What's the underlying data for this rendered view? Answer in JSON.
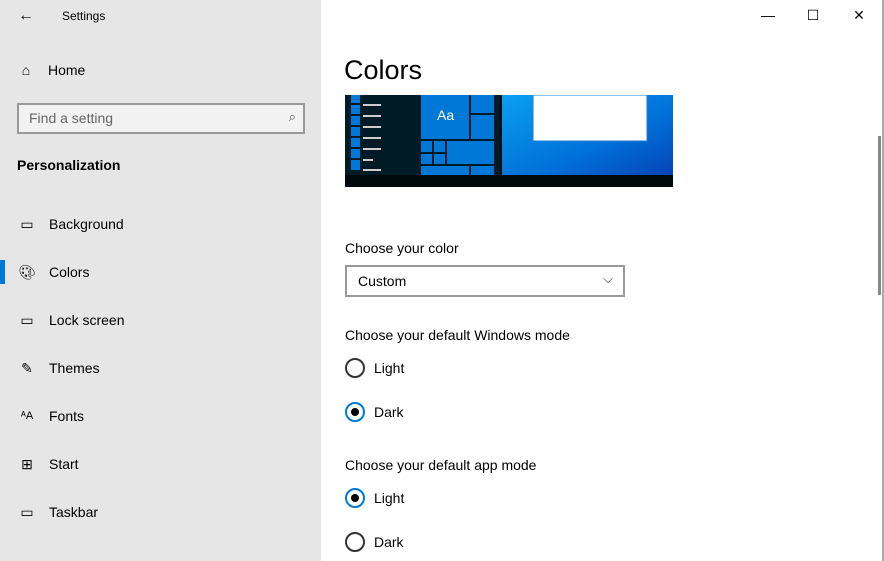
{
  "app": {
    "title": "Settings"
  },
  "sidebar": {
    "home": "Home",
    "search_placeholder": "Find a setting",
    "section": "Personalization",
    "items": [
      {
        "label": "Background",
        "icon": "picture-icon"
      },
      {
        "label": "Colors",
        "icon": "palette-icon",
        "selected": true
      },
      {
        "label": "Lock screen",
        "icon": "lock-screen-icon"
      },
      {
        "label": "Themes",
        "icon": "themes-icon"
      },
      {
        "label": "Fonts",
        "icon": "fonts-icon"
      },
      {
        "label": "Start",
        "icon": "start-icon"
      },
      {
        "label": "Taskbar",
        "icon": "taskbar-icon"
      }
    ]
  },
  "main": {
    "title": "Colors",
    "preview_tile_text": "Aa",
    "choose_color_label": "Choose your color",
    "choose_color_value": "Custom",
    "windows_mode_label": "Choose your default Windows mode",
    "windows_mode": [
      {
        "label": "Light",
        "checked": false
      },
      {
        "label": "Dark",
        "checked": true
      }
    ],
    "app_mode_label": "Choose your default app mode",
    "app_mode": [
      {
        "label": "Light",
        "checked": true
      },
      {
        "label": "Dark",
        "checked": false
      }
    ]
  },
  "colors": {
    "accent": "#0078d7",
    "sidebar_bg": "#e6e6e6"
  }
}
